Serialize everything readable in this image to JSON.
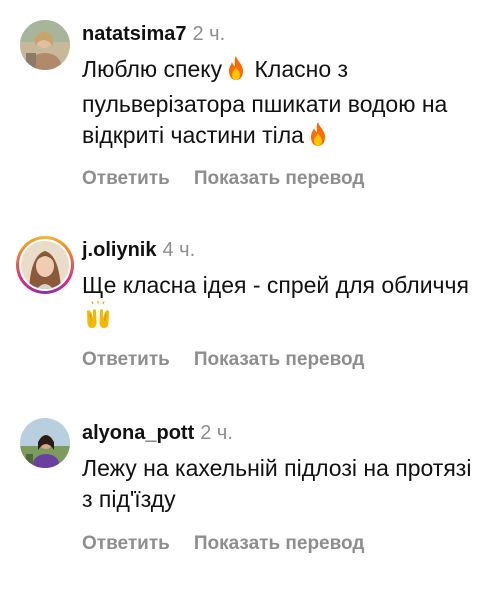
{
  "comments": [
    {
      "username": "natatsima7",
      "time": "2 ч.",
      "text_parts": [
        "Люблю спеку",
        " Класно з пульверізатора пшикати водою на відкриті частини тіла"
      ],
      "emoji_1": "fire",
      "emoji_2": "fire",
      "reply_label": "Ответить",
      "translate_label": "Показать перевод"
    },
    {
      "username": "j.oliynik",
      "time": "4 ч.",
      "text_parts": [
        "Ще класна ідея - спрей для обличчя"
      ],
      "emoji_1": "raising-hands",
      "reply_label": "Ответить",
      "translate_label": "Показать перевод"
    },
    {
      "username": "alyona_pott",
      "time": "2 ч.",
      "text_parts": [
        "Лежу на кахельній підлозі на протязі з під'їзду"
      ],
      "reply_label": "Ответить",
      "translate_label": "Показать перевод"
    }
  ],
  "colors": {
    "text": "#111111",
    "secondary": "#8e8e8e",
    "fire": "#ff6a00",
    "hands": "#f5b800"
  }
}
